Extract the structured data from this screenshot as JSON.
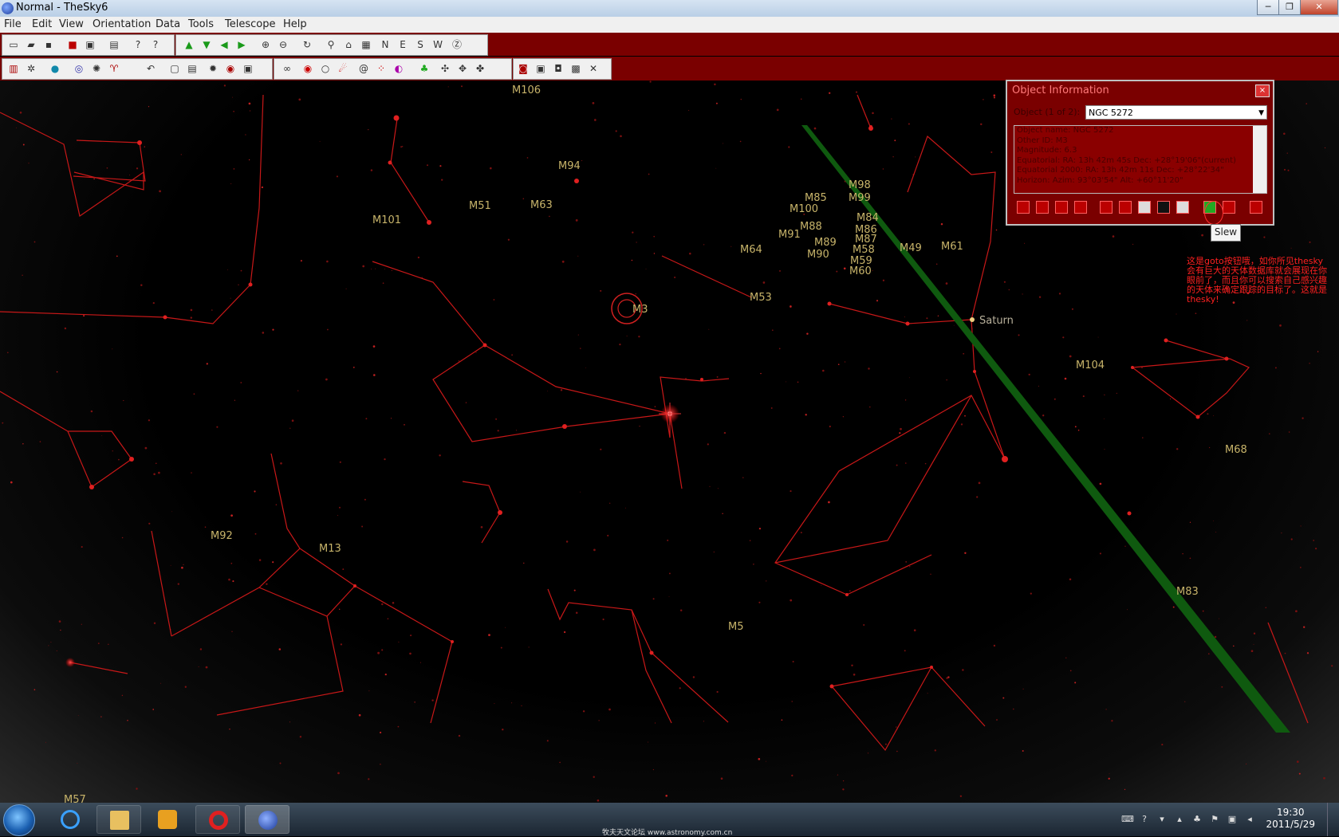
{
  "window": {
    "title": "Normal - TheSky6",
    "minimize": "─",
    "maximize": "❐",
    "close": "✕"
  },
  "menu": [
    "File",
    "Edit",
    "View",
    "Orientation",
    "Data",
    "Tools",
    "Telescope",
    "Help"
  ],
  "toolbar_compass": [
    "N",
    "E",
    "S",
    "W"
  ],
  "sky_objects": [
    {
      "label": "M106"
    },
    {
      "label": "M94"
    },
    {
      "label": "M51"
    },
    {
      "label": "M63"
    },
    {
      "label": "M101"
    },
    {
      "label": "M98"
    },
    {
      "label": "M85"
    },
    {
      "label": "M99"
    },
    {
      "label": "M100"
    },
    {
      "label": "M84"
    },
    {
      "label": "M88"
    },
    {
      "label": "M86"
    },
    {
      "label": "M91"
    },
    {
      "label": "M87"
    },
    {
      "label": "M89"
    },
    {
      "label": "M58"
    },
    {
      "label": "M90"
    },
    {
      "label": "M49"
    },
    {
      "label": "M61"
    },
    {
      "label": "M64"
    },
    {
      "label": "M59"
    },
    {
      "label": "M60"
    },
    {
      "label": "M53"
    },
    {
      "label": "M3"
    },
    {
      "label": "M104"
    },
    {
      "label": "M68"
    },
    {
      "label": "M92"
    },
    {
      "label": "M13"
    },
    {
      "label": "M5"
    },
    {
      "label": "M83"
    },
    {
      "label": "M57"
    }
  ],
  "planet": {
    "label": "Saturn"
  },
  "annotation": "这是goto按钮哦，如你所见thesky会有巨大的天体数据库就会展现在你眼前了，而且你可以搜索自己感兴趣的天体来确定跟踪的目标了。这就是thesky!",
  "object_info": {
    "title": "Object Information",
    "count_label": "Object (1 of 2):",
    "selected": "NGC 5272",
    "lines": [
      "Object name: NGC 5272",
      "Other ID: M3",
      "Magnitude: 6.3",
      "Equatorial: RA: 13h 42m 45s   Dec: +28°19'06\"(current)",
      "Equatorial 2000: RA: 13h 42m 11s   Dec: +28°22'34\"",
      "Horizon: Azim: 93°03'54\"   Alt: +60°11'20\""
    ],
    "tooltip": "Slew"
  },
  "taskbar": {
    "time": "19:30",
    "date": "2011/5/29",
    "watermark": "牧夫天文论坛 www.astronomy.com.cn"
  },
  "colors": {
    "constellation": "#c81818",
    "toolbar": "#7a0000",
    "label": "#c8b46a",
    "horizon_band": "#0f5a0f"
  }
}
